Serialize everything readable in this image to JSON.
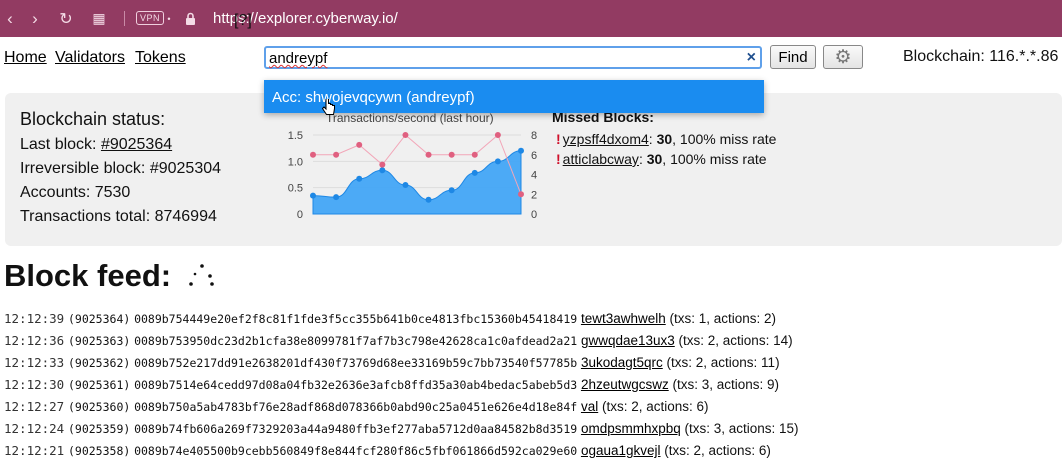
{
  "browser": {
    "url": "https://explorer.cyberway.io/",
    "vpn_label": "VPN"
  },
  "nav": {
    "home": "Home",
    "validators": "Validators",
    "tokens": "Tokens",
    "help": "[?]",
    "search_value": "andreypf",
    "clear": "×",
    "find": "Find",
    "settings_icon": "gear-icon",
    "blockchain_label": "Blockchain: 116.*.*.86"
  },
  "suggestion": {
    "text": "Acc: shwojevqcywn (andreypf)"
  },
  "status": {
    "title": "Blockchain status:",
    "last_block_label": "Last block: ",
    "last_block_value": "#9025364",
    "irreversible": "Irreversible block: #9025304",
    "accounts": "Accounts: 7530",
    "transactions": "Transactions total: 8746994"
  },
  "chart_data": {
    "type": "area",
    "title": "Transactions/second (last hour)",
    "y_left_ticks": [
      "1.5",
      "1.0",
      "0.5",
      "0"
    ],
    "y_right_ticks": [
      "8",
      "6",
      "4",
      "2",
      "0"
    ],
    "ylim_left": [
      0,
      1.5
    ],
    "ylim_right": [
      0,
      8
    ],
    "series": [
      {
        "axis": "left",
        "color": "#1e88e5",
        "values": [
          0.35,
          0.32,
          0.67,
          0.83,
          0.55,
          0.27,
          0.45,
          0.78,
          1.0,
          1.2
        ]
      },
      {
        "axis": "right",
        "color": "#e06080",
        "values": [
          6.0,
          6.0,
          7.0,
          5.0,
          8.0,
          6.0,
          6.0,
          6.0,
          8.0,
          2.0
        ]
      }
    ]
  },
  "missed": {
    "title": "Missed Blocks:",
    "rows": [
      {
        "name": "yzpsff4dxom4",
        "count": "30",
        "rate": ", 100% miss rate"
      },
      {
        "name": "atticlabcway",
        "count": "30",
        "rate": ", 100% miss rate"
      }
    ]
  },
  "feed": {
    "title": "Block feed:",
    "rows": [
      {
        "time": "12:12:39",
        "num": "(9025364)",
        "hash": "0089b754449e20ef2f8c81f1fde3f5cc355b641b0ce4813fbc15360b45418419",
        "producer": "tewt3awhwelh",
        "info": "(txs: 1, actions: 2)"
      },
      {
        "time": "12:12:36",
        "num": "(9025363)",
        "hash": "0089b753950dc23d2b1cfa38e8099781f7af7b3c798e42628ca1c0afdead2a21",
        "producer": "gwwqdae13ux3",
        "info": "(txs: 2, actions: 14)"
      },
      {
        "time": "12:12:33",
        "num": "(9025362)",
        "hash": "0089b752e217dd91e2638201df430f73769d68ee33169b59c7bb73540f57785b",
        "producer": "3ukodagt5qrc",
        "info": "(txs: 2, actions: 11)"
      },
      {
        "time": "12:12:30",
        "num": "(9025361)",
        "hash": "0089b7514e64cedd97d08a04fb32e2636e3afcb8ffd35a30ab4bedac5abeb5d3",
        "producer": "2hzeutwgcswz",
        "info": "(txs: 3, actions: 9)"
      },
      {
        "time": "12:12:27",
        "num": "(9025360)",
        "hash": "0089b750a5ab4783bf76e28adf868d078366b0abd90c25a0451e626e4d18e84f",
        "producer": "val",
        "info": "(txs: 2, actions: 6)"
      },
      {
        "time": "12:12:24",
        "num": "(9025359)",
        "hash": "0089b74fb606a269f7329203a44a9480ffb3ef277aba5712d0aa84582b8d3519",
        "producer": "omdpsmmhxpbq",
        "info": "(txs: 3, actions: 15)"
      },
      {
        "time": "12:12:21",
        "num": "(9025358)",
        "hash": "0089b74e405500b9cebb560849f8e844fcf280f86c5fbf061866d592ca029e60",
        "producer": "ogaua1gkvejl",
        "info": "(txs: 2, actions: 6)"
      }
    ]
  }
}
